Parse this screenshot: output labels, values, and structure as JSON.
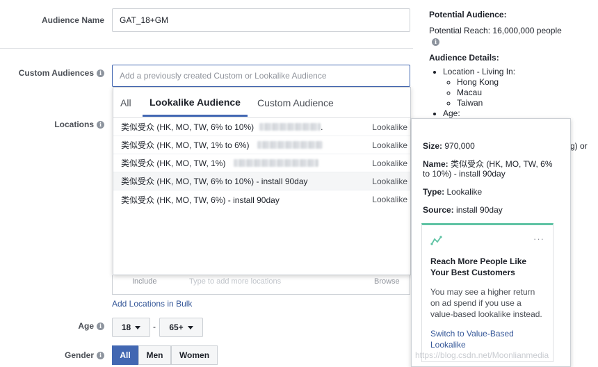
{
  "form": {
    "audience_name_label": "Audience Name",
    "audience_name_value": "GAT_18+GM",
    "custom_audiences_label": "Custom Audiences",
    "custom_audiences_placeholder": "Add a previously created Custom or Lookalike Audience",
    "locations_label": "Locations",
    "include_label": "Include",
    "locations_placeholder": "Type to add more locations",
    "browse_label": "Browse",
    "add_locations_bulk": "Add Locations in Bulk",
    "age_label": "Age",
    "age_min": "18",
    "age_max": "65+",
    "age_separator": "-",
    "gender_label": "Gender",
    "gender_options": [
      "All",
      "Men",
      "Women"
    ],
    "gender_selected": "All"
  },
  "dropdown": {
    "tabs": [
      "All",
      "Lookalike Audience",
      "Custom Audience"
    ],
    "active_tab": "Lookalike Audience",
    "items": [
      {
        "name": "类似受众 (HK, MO, TW, 6% to 10%)",
        "suffix": ".",
        "type": "Lookalike"
      },
      {
        "name": "类似受众 (HK, MO, TW, 1% to 6%)",
        "suffix": "",
        "type": "Lookalike"
      },
      {
        "name": "类似受众 (HK, MO, TW, 1%)",
        "suffix": "",
        "type": "Lookalike"
      },
      {
        "name": "类似受众 (HK, MO, TW, 6% to 10%) - install 90day",
        "suffix": "",
        "type": "Lookalike"
      },
      {
        "name": "类似受众 (HK, MO, TW, 6%) - install 90day",
        "suffix": "",
        "type": "Lookalike"
      }
    ]
  },
  "side": {
    "potential_audience_title": "Potential Audience:",
    "potential_reach": "Potential Reach: 16,000,000 people",
    "audience_details_title": "Audience Details:",
    "location_label": "Location - Living In:",
    "locations": [
      "Hong Kong",
      "Macau",
      "Taiwan"
    ],
    "age_item": "Age:",
    "overflow_text": "g) or"
  },
  "tooltip": {
    "size_label": "Size:",
    "size_value": "970,000",
    "name_label": "Name:",
    "name_value_line1": "类似受众 (HK, MO, TW, 6%",
    "name_value_line2": "to 10%) - install 90day",
    "type_label": "Type:",
    "type_value": "Lookalike",
    "source_label": "Source:",
    "source_value": "install 90day",
    "card_title_line1": "Reach More People Like",
    "card_title_line2": "Your Best Customers",
    "card_body_line1": "You may see a higher return",
    "card_body_line2": "on ad spend if you use a",
    "card_body_line3": "value-based lookalike instead.",
    "card_link_line1": "Switch to Value-Based",
    "card_link_line2": "Lookalike",
    "more_dots": "···"
  },
  "watermark": "https://blog.csdn.net/Moonlianmedia",
  "colors": {
    "accent": "#4267b2",
    "card_accent": "#5fc3a4",
    "link": "#365899"
  }
}
